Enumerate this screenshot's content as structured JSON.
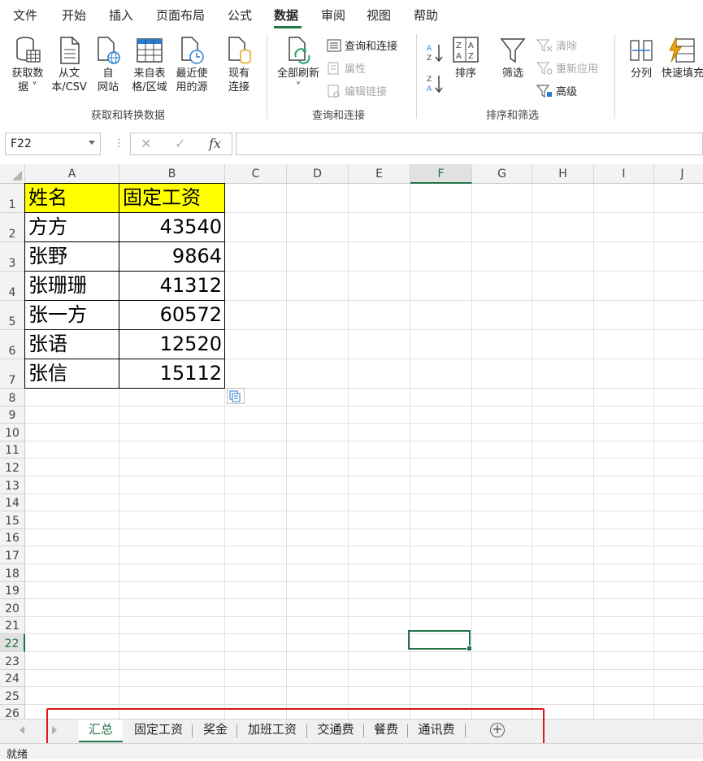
{
  "menu": {
    "tabs": [
      "文件",
      "开始",
      "插入",
      "页面布局",
      "公式",
      "数据",
      "审阅",
      "视图",
      "帮助"
    ],
    "active": "数据"
  },
  "ribbon": {
    "get_data_label": "获取数\n据 ˅",
    "from_text_label": "从文\n本/CSV",
    "from_web_label": "自\n网站",
    "from_table_label": "来自表\n格/区域",
    "recent_sources_label": "最近使\n用的源",
    "existing_conn_label": "现有\n连接",
    "group1_label": "获取和转换数据",
    "refresh_all_label": "全部刷新\n˅",
    "queries_conn_label": "查询和连接",
    "properties_label": "属性",
    "edit_links_label": "编辑链接",
    "group2_label": "查询和连接",
    "sort_label": "排序",
    "filter_label": "筛选",
    "clear_label": "清除",
    "reapply_label": "重新应用",
    "advanced_label": "高级",
    "group3_label": "排序和筛选",
    "split_label": "分列",
    "flash_fill_label": "快速填充"
  },
  "formula_bar": {
    "name_box": "F22",
    "cancel": "✕",
    "enter": "✓",
    "fx": "fx",
    "value": ""
  },
  "columns": [
    "A",
    "B",
    "C",
    "D",
    "E",
    "F",
    "G",
    "H",
    "I",
    "J"
  ],
  "selected_column": "F",
  "rows": [
    "1",
    "2",
    "3",
    "4",
    "5",
    "6",
    "7",
    "8",
    "9",
    "10",
    "11",
    "12",
    "13",
    "14",
    "15",
    "16",
    "17",
    "18",
    "19",
    "20",
    "21",
    "22",
    "23",
    "24",
    "25",
    "26"
  ],
  "selected_row": "22",
  "table": {
    "header": [
      "姓名",
      "固定工资"
    ],
    "rows": [
      [
        "方方",
        "43540"
      ],
      [
        "张野",
        "9864"
      ],
      [
        "张珊珊",
        "41312"
      ],
      [
        "张一方",
        "60572"
      ],
      [
        "张语",
        "12520"
      ],
      [
        "张信",
        "15112"
      ]
    ],
    "header_fill": "#ffff00"
  },
  "sheets": {
    "tabs": [
      "汇总",
      "固定工资",
      "奖金",
      "加班工资",
      "交通费",
      "餐费",
      "通讯费"
    ],
    "active": "汇总",
    "add_symbol": "+"
  },
  "status": {
    "text": "就绪"
  },
  "colors": {
    "accent": "#217346",
    "highlight_border": "#e0161b"
  }
}
